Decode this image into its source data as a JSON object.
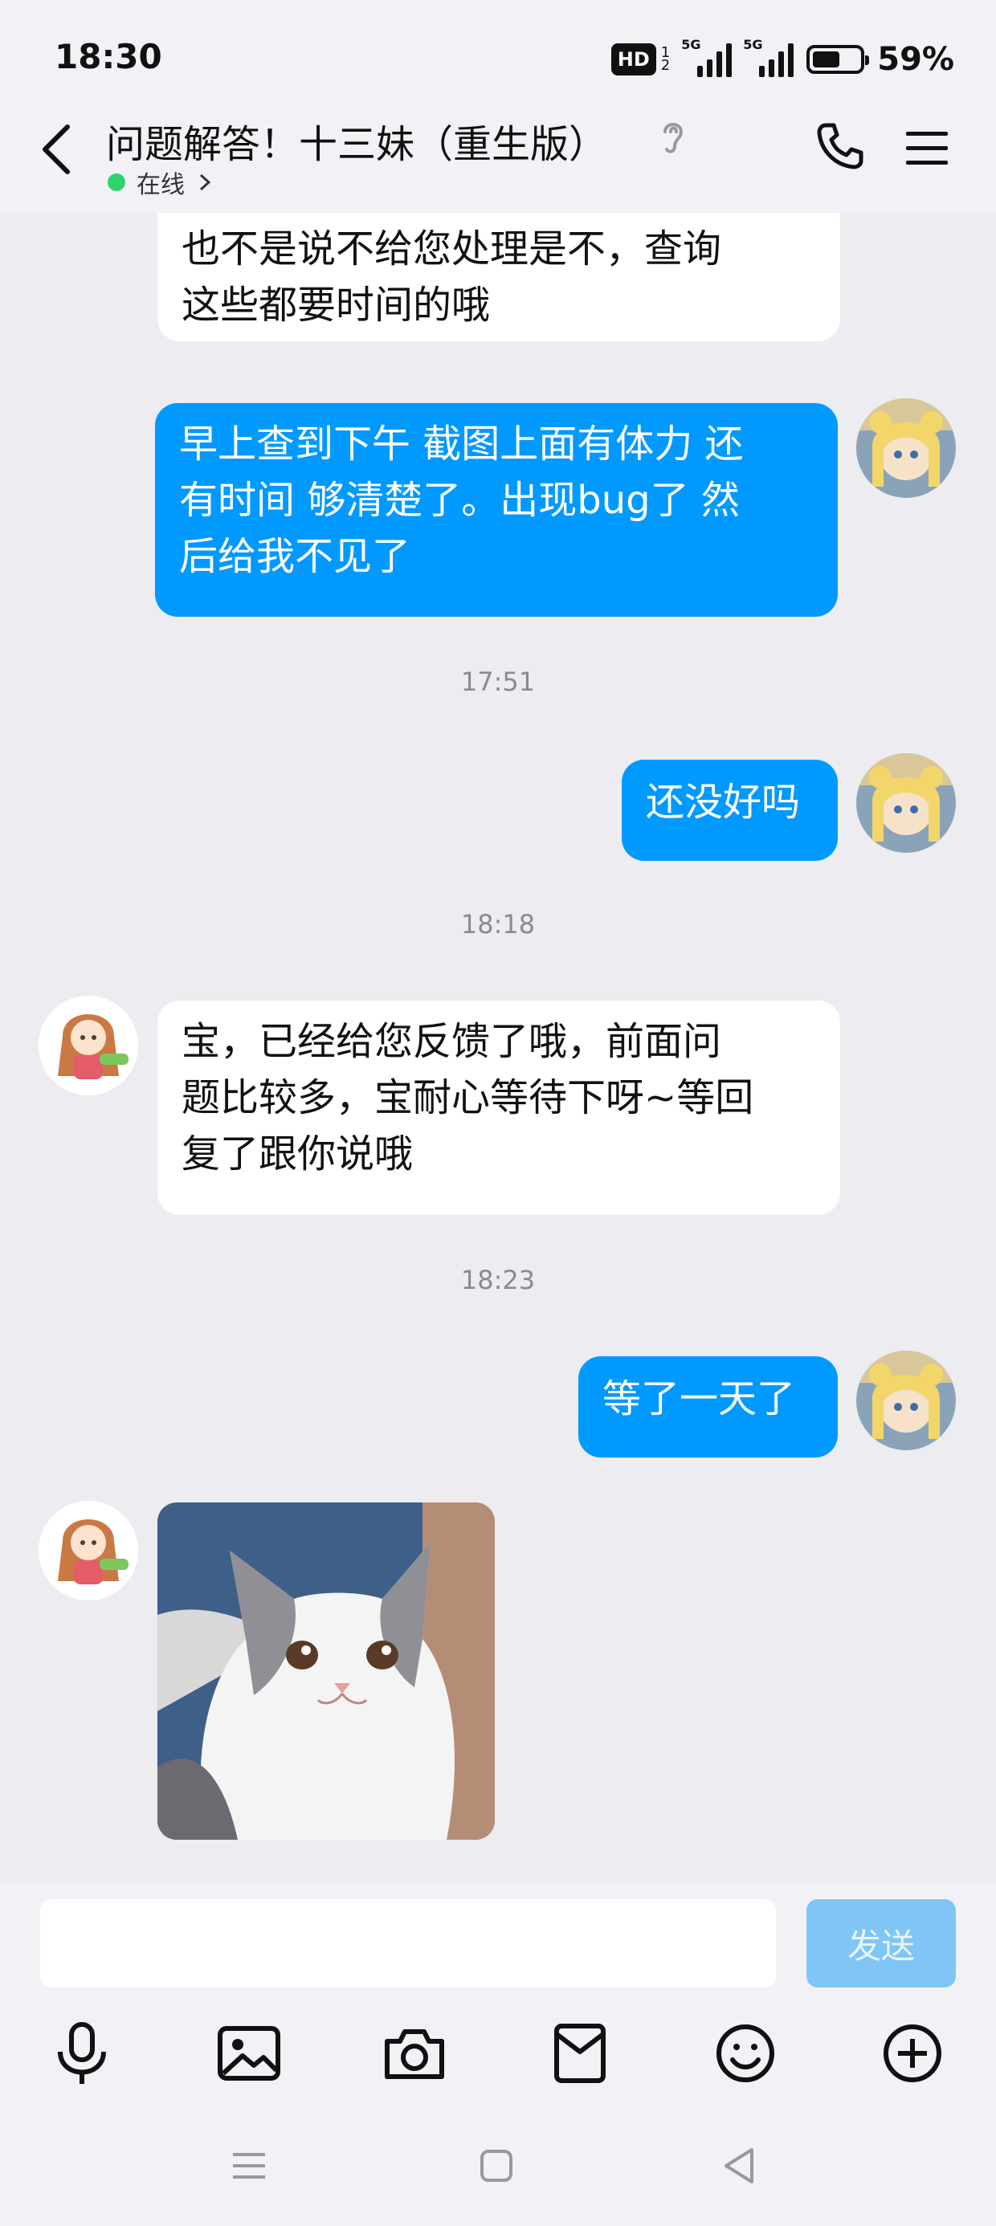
{
  "status_bar": {
    "time": "18:30",
    "hd_label": "HD",
    "hd_sub_1": "1",
    "hd_sub_2": "2",
    "net_1": "5G",
    "net_2": "5G",
    "battery_percent": "59%",
    "battery_level": 0.59
  },
  "header": {
    "title": "问题解答！十三妹（重生版）",
    "status": "在线",
    "status_color": "#2ed36b",
    "icons": [
      "back-icon",
      "ear-icon",
      "phone-icon",
      "menu-icon"
    ]
  },
  "messages": [
    {
      "side": "in",
      "lines": [
        "也不是说不给您处理是不，查询",
        "这些都要时间的哦"
      ]
    },
    {
      "side": "out",
      "lines": [
        "早上查到下午 截图上面有体力 还",
        "有时间 够清楚了。出现bug了 然",
        "后给我不见了"
      ]
    },
    {
      "timestamp": "17:51"
    },
    {
      "side": "out",
      "lines": [
        "还没好吗"
      ]
    },
    {
      "timestamp": "18:18"
    },
    {
      "side": "in",
      "lines": [
        "宝，已经给您反馈了哦，前面问",
        "题比较多，宝耐心等待下呀~等回",
        "复了跟你说哦"
      ]
    },
    {
      "timestamp": "18:23"
    },
    {
      "side": "out",
      "lines": [
        "等了一天了"
      ]
    },
    {
      "side": "in",
      "type": "sticker",
      "content": "cat-sticker"
    }
  ],
  "input": {
    "value": "",
    "send_label": "发送"
  },
  "toolbar": [
    "microphone-icon",
    "image-icon",
    "camera-icon",
    "red-packet-icon",
    "emoji-icon",
    "plus-icon"
  ],
  "colors": {
    "accent": "#0099ff",
    "background": "#ececf1",
    "send_disabled": "#7fc5f6"
  }
}
